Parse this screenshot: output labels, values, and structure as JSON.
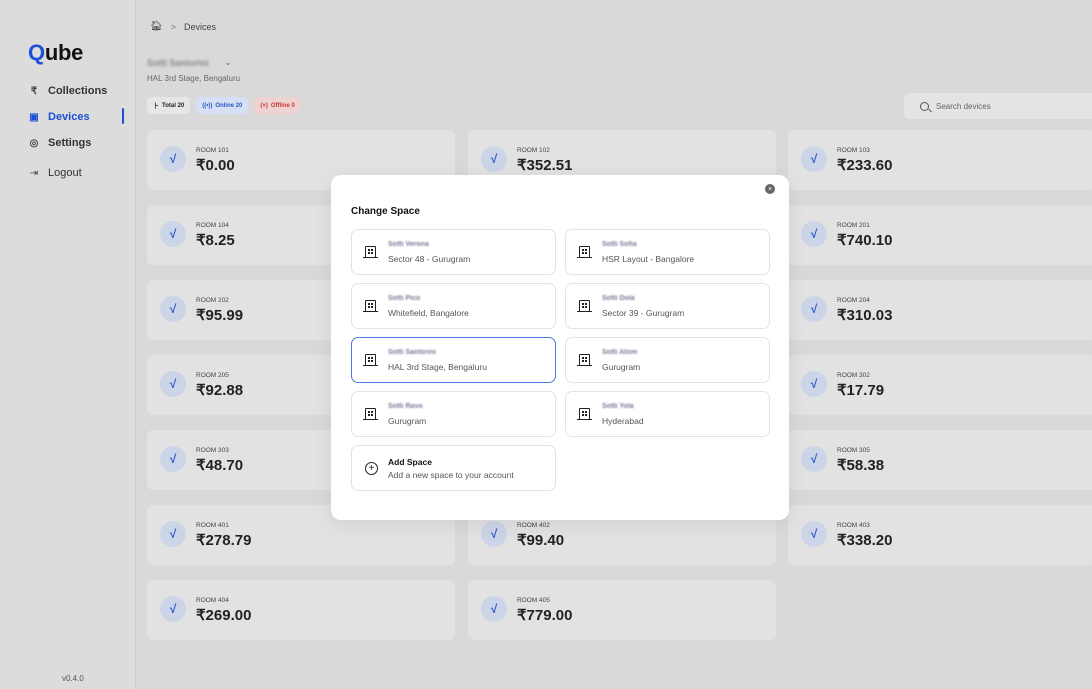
{
  "app": {
    "logo_q": "Q",
    "logo_rest": "ube",
    "version": "v0.4.0"
  },
  "sidebar": {
    "items": [
      {
        "label": "Collections",
        "icon": "rupee-icon",
        "glyph": "₹"
      },
      {
        "label": "Devices",
        "icon": "device-icon",
        "glyph": "▣",
        "active": true
      },
      {
        "label": "Settings",
        "icon": "gear-icon",
        "glyph": "◎"
      },
      {
        "label": "Logout",
        "icon": "logout-icon",
        "glyph": "⇥"
      }
    ]
  },
  "breadcrumb": {
    "home_glyph": "🏠︎",
    "separator": ">",
    "current": "Devices"
  },
  "space": {
    "name": "Sotti Santorini",
    "location": "HAL 3rd Stage, Bengaluru",
    "chevron": "⌄"
  },
  "filters": {
    "total": "Total 20",
    "online": "Online 20",
    "offline": "Offline 0"
  },
  "search": {
    "placeholder": "Search devices"
  },
  "devices": [
    {
      "room": "ROOM 101",
      "amount": "₹0.00"
    },
    {
      "room": "ROOM 102",
      "amount": "₹352.51"
    },
    {
      "room": "ROOM 103",
      "amount": "₹233.60"
    },
    {
      "room": "ROOM 104",
      "amount": "₹8.25"
    },
    {
      "room": "",
      "amount": ""
    },
    {
      "room": "ROOM 201",
      "amount": "₹740.10"
    },
    {
      "room": "ROOM 202",
      "amount": "₹95.99"
    },
    {
      "room": "",
      "amount": ""
    },
    {
      "room": "ROOM 204",
      "amount": "₹310.03"
    },
    {
      "room": "ROOM 205",
      "amount": "₹92.88"
    },
    {
      "room": "",
      "amount": ""
    },
    {
      "room": "ROOM 302",
      "amount": "₹17.79"
    },
    {
      "room": "ROOM 303",
      "amount": "₹48.70"
    },
    {
      "room": "",
      "amount": ""
    },
    {
      "room": "ROOM 305",
      "amount": "₹58.38"
    },
    {
      "room": "ROOM 401",
      "amount": "₹278.79"
    },
    {
      "room": "ROOM 402",
      "amount": "₹99.40"
    },
    {
      "room": "ROOM 403",
      "amount": "₹338.20"
    },
    {
      "room": "ROOM 404",
      "amount": "₹269.00"
    },
    {
      "room": "ROOM 405",
      "amount": "₹779.00"
    }
  ],
  "modal": {
    "title": "Change Space",
    "close_glyph": "×",
    "spaces": [
      {
        "name": "Sotti Verona",
        "location": "Sector 48 - Gurugram"
      },
      {
        "name": "Sotti Sofia",
        "location": "HSR Layout - Bangalore"
      },
      {
        "name": "Sotti Pico",
        "location": "Whitefield, Bangalore"
      },
      {
        "name": "Sotti Dola",
        "location": "Sector 39 - Gurugram"
      },
      {
        "name": "Sotti Santorini",
        "location": "HAL 3rd Stage, Bengaluru",
        "selected": true
      },
      {
        "name": "Sotti Atom",
        "location": "Gurugram"
      },
      {
        "name": "Sotti Ravo",
        "location": "Gurugram"
      },
      {
        "name": "Sotti Yola",
        "location": "Hyderabad"
      }
    ],
    "add": {
      "title": "Add Space",
      "subtitle": "Add a new space to your account",
      "glyph": "+"
    }
  },
  "colors": {
    "accent": "#1d4fd7",
    "online": "#2a56c8",
    "offline": "#c43a3a"
  }
}
